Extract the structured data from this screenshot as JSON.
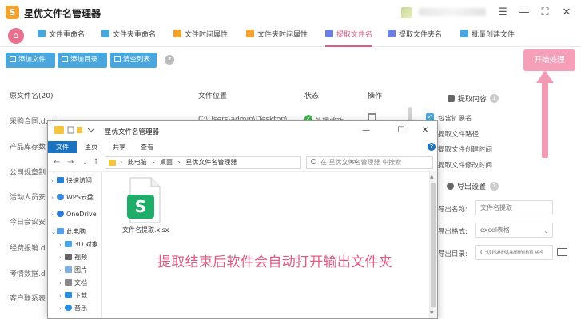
{
  "app": {
    "title": "星优文件名管理器",
    "logo_char": "S"
  },
  "window_controls": {
    "menu_glyph": "☰",
    "minimize_glyph": "—",
    "maximize_glyph": "⛶",
    "close_glyph": "✕"
  },
  "tabs": [
    {
      "label": "文件重命名",
      "active": false,
      "icon_color": "#4aa7dd"
    },
    {
      "label": "文件夹重命名",
      "active": false,
      "icon_color": "#4aa7dd"
    },
    {
      "label": "文件时间属性",
      "active": false,
      "icon_color": "#f4a22d"
    },
    {
      "label": "文件夹时间属性",
      "active": false,
      "icon_color": "#f4a22d"
    },
    {
      "label": "提取文件名",
      "active": true,
      "icon_color": "#6c7ee1"
    },
    {
      "label": "提取文件夹名",
      "active": false,
      "icon_color": "#6c7ee1"
    },
    {
      "label": "批量创建文件",
      "active": false,
      "icon_color": "#4aa7dd"
    }
  ],
  "toolbar": {
    "add_file": "添加文件",
    "add_folder": "添加目录",
    "clear_list": "清空列表",
    "help": "?",
    "start": "开始处理"
  },
  "table": {
    "headers": {
      "name": "原文件名(20)",
      "location": "文件位置",
      "status": "状态",
      "action": "操作"
    },
    "rows": [
      {
        "name": "采购合同.docx",
        "path": "C:\\Users\\admin\\Desktop\\...",
        "status": "处理成功"
      },
      {
        "name": "产品库存数"
      },
      {
        "name": "公司规章制"
      },
      {
        "name": "活动人员安"
      },
      {
        "name": "今日会议安"
      },
      {
        "name": "经费报销.d"
      },
      {
        "name": "考情数据.d"
      },
      {
        "name": "客户联系表"
      }
    ]
  },
  "settings": {
    "extract_title": "提取内容",
    "options": [
      {
        "label": "包含扩展名",
        "checked": true
      },
      {
        "label": "提取文件路径",
        "checked": false
      },
      {
        "label": "提取文件创建时间",
        "checked": false
      },
      {
        "label": "提取文件修改时间",
        "checked": false
      }
    ],
    "export_title": "导出设置",
    "export_name_label": "导出名称:",
    "export_name_value": "文件名提取",
    "export_format_label": "导出格式:",
    "export_format_value": "excel表格",
    "export_dir_label": "导出目录:",
    "export_dir_value": "C:\\Users\\admin\\Des"
  },
  "explorer": {
    "title": "星优文件名管理器",
    "ribbon_tabs": [
      "文件",
      "主页",
      "共享",
      "查看"
    ],
    "address_parts": [
      "此电脑",
      "桌面",
      "星优文件名管理器"
    ],
    "address_separator": "›",
    "search_placeholder": "在 星优文件名管理器 中搜索",
    "nav_items": [
      {
        "label": "快速访问",
        "chevron": "›",
        "icon_color": "#2f7fd0",
        "sub": false
      },
      {
        "label": "WPS云盘",
        "chevron": "›",
        "icon_color": "#3b8be3",
        "sub": false
      },
      {
        "label": "OneDrive",
        "chevron": "›",
        "icon_color": "#2b7ad4",
        "sub": false
      },
      {
        "label": "此电脑",
        "chevron": "⌄",
        "icon_color": "#5aa0e0",
        "sub": false
      },
      {
        "label": "3D 对象",
        "chevron": "›",
        "icon_color": "#48a5e8",
        "sub": true
      },
      {
        "label": "视频",
        "chevron": "›",
        "icon_color": "#666666",
        "sub": true
      },
      {
        "label": "图片",
        "chevron": "›",
        "icon_color": "#7fb0e0",
        "sub": true
      },
      {
        "label": "文档",
        "chevron": "›",
        "icon_color": "#888888",
        "sub": true
      },
      {
        "label": "下载",
        "chevron": "›",
        "icon_color": "#2a8ee0",
        "sub": true
      },
      {
        "label": "音乐",
        "chevron": "›",
        "icon_color": "#2a8ee0",
        "sub": true
      }
    ],
    "file": {
      "name": "文件名提取.xlsx",
      "icon_letter": "S",
      "icon_color": "#1fae6a"
    }
  },
  "annotation": "提取结束后软件会自动打开输出文件夹",
  "colors": {
    "accent_pink": "#e35b83",
    "button_blue": "#4aa7dd",
    "start_button": "#f5a0b8",
    "success_green": "#41b24e"
  }
}
